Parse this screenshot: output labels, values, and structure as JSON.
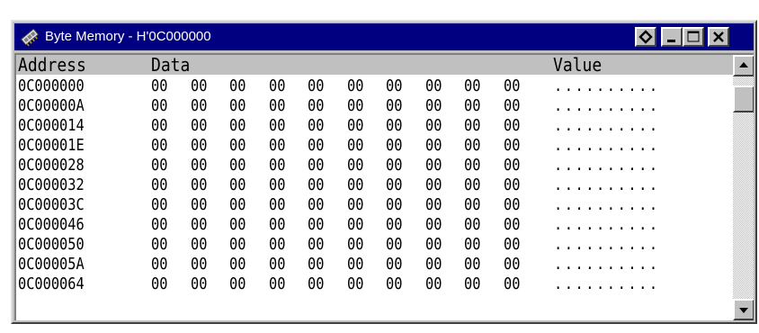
{
  "window": {
    "title": "Byte Memory - H'0C000000",
    "icon": "memory-chip-icon",
    "buttons": [
      "pin-icon",
      "minimize-icon",
      "maximize-icon",
      "close-icon"
    ]
  },
  "header": {
    "address": "Address",
    "data": "Data",
    "value": "Value"
  },
  "rows": [
    {
      "address": "0C000000",
      "bytes": [
        "00",
        "00",
        "00",
        "00",
        "00",
        "00",
        "00",
        "00",
        "00",
        "00"
      ],
      "value": ".........."
    },
    {
      "address": "0C00000A",
      "bytes": [
        "00",
        "00",
        "00",
        "00",
        "00",
        "00",
        "00",
        "00",
        "00",
        "00"
      ],
      "value": ".........."
    },
    {
      "address": "0C000014",
      "bytes": [
        "00",
        "00",
        "00",
        "00",
        "00",
        "00",
        "00",
        "00",
        "00",
        "00"
      ],
      "value": ".........."
    },
    {
      "address": "0C00001E",
      "bytes": [
        "00",
        "00",
        "00",
        "00",
        "00",
        "00",
        "00",
        "00",
        "00",
        "00"
      ],
      "value": ".........."
    },
    {
      "address": "0C000028",
      "bytes": [
        "00",
        "00",
        "00",
        "00",
        "00",
        "00",
        "00",
        "00",
        "00",
        "00"
      ],
      "value": ".........."
    },
    {
      "address": "0C000032",
      "bytes": [
        "00",
        "00",
        "00",
        "00",
        "00",
        "00",
        "00",
        "00",
        "00",
        "00"
      ],
      "value": ".........."
    },
    {
      "address": "0C00003C",
      "bytes": [
        "00",
        "00",
        "00",
        "00",
        "00",
        "00",
        "00",
        "00",
        "00",
        "00"
      ],
      "value": ".........."
    },
    {
      "address": "0C000046",
      "bytes": [
        "00",
        "00",
        "00",
        "00",
        "00",
        "00",
        "00",
        "00",
        "00",
        "00"
      ],
      "value": ".........."
    },
    {
      "address": "0C000050",
      "bytes": [
        "00",
        "00",
        "00",
        "00",
        "00",
        "00",
        "00",
        "00",
        "00",
        "00"
      ],
      "value": ".........."
    },
    {
      "address": "0C00005A",
      "bytes": [
        "00",
        "00",
        "00",
        "00",
        "00",
        "00",
        "00",
        "00",
        "00",
        "00"
      ],
      "value": ".........."
    },
    {
      "address": "0C000064",
      "bytes": [
        "00",
        "00",
        "00",
        "00",
        "00",
        "00",
        "00",
        "00",
        "00",
        "00"
      ],
      "value": ".........."
    }
  ],
  "colors": {
    "titlebar": "#000080",
    "chrome": "#c0c0c0"
  }
}
